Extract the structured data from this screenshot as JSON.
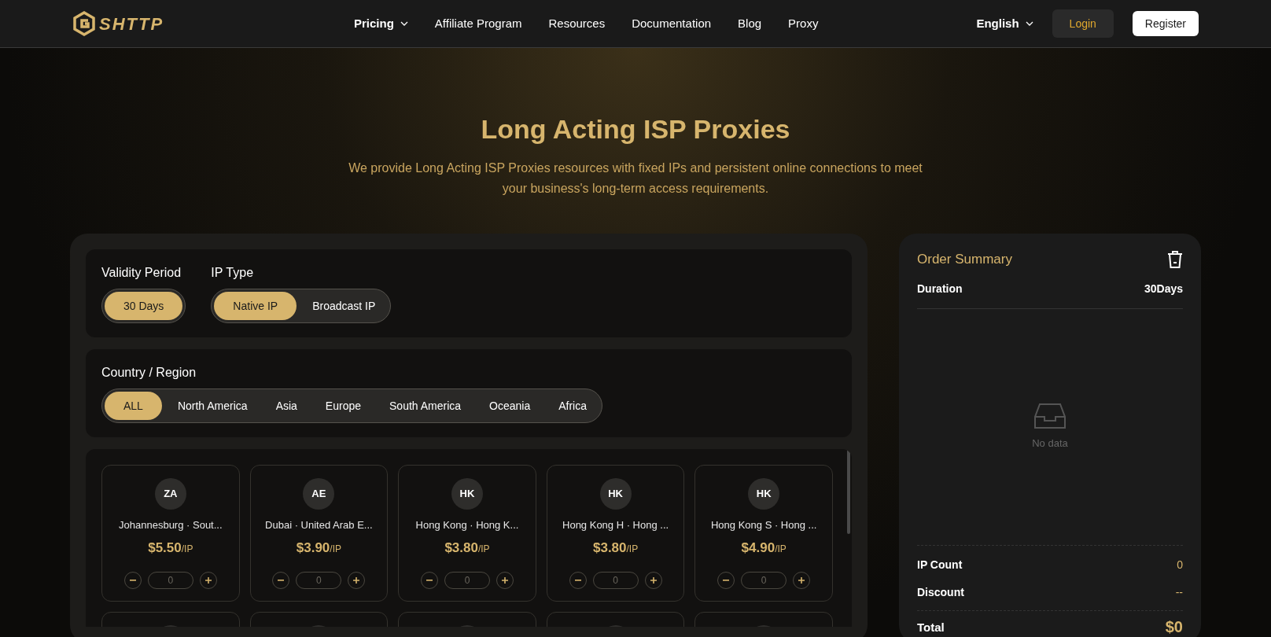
{
  "header": {
    "logo": "SHTTP",
    "nav": [
      {
        "label": "Pricing",
        "dropdown": true
      },
      {
        "label": "Affiliate Program",
        "dropdown": false
      },
      {
        "label": "Resources",
        "dropdown": false
      },
      {
        "label": "Documentation",
        "dropdown": false
      },
      {
        "label": "Blog",
        "dropdown": false
      },
      {
        "label": "Proxy",
        "dropdown": false
      }
    ],
    "language": "English",
    "login": "Login",
    "register": "Register"
  },
  "hero": {
    "title": "Long Acting ISP Proxies",
    "subtitle": "We provide Long Acting ISP Proxies resources with fixed IPs and persistent online connections to meet your business's long-term access requirements."
  },
  "validity_period": {
    "label": "Validity Period",
    "options": [
      {
        "label": "30 Days",
        "selected": true
      }
    ]
  },
  "ip_type": {
    "label": "IP Type",
    "options": [
      {
        "label": "Native IP",
        "selected": true
      },
      {
        "label": "Broadcast IP",
        "selected": false
      }
    ]
  },
  "region": {
    "label": "Country / Region",
    "options": [
      {
        "label": "ALL",
        "selected": true
      },
      {
        "label": "North America",
        "selected": false
      },
      {
        "label": "Asia",
        "selected": false
      },
      {
        "label": "Europe",
        "selected": false
      },
      {
        "label": "South America",
        "selected": false
      },
      {
        "label": "Oceania",
        "selected": false
      },
      {
        "label": "Africa",
        "selected": false
      }
    ]
  },
  "products": [
    {
      "code": "ZA",
      "name": "Johannesburg · Sout...",
      "price": "$5.50",
      "unit": "/IP",
      "quantity": "0"
    },
    {
      "code": "AE",
      "name": "Dubai · United Arab E...",
      "price": "$3.90",
      "unit": "/IP",
      "quantity": "0"
    },
    {
      "code": "HK",
      "name": "Hong Kong · Hong K...",
      "price": "$3.80",
      "unit": "/IP",
      "quantity": "0"
    },
    {
      "code": "HK",
      "name": "Hong Kong H · Hong ...",
      "price": "$3.80",
      "unit": "/IP",
      "quantity": "0"
    },
    {
      "code": "HK",
      "name": "Hong Kong S · Hong ...",
      "price": "$4.90",
      "unit": "/IP",
      "quantity": "0"
    }
  ],
  "summary": {
    "title": "Order Summary",
    "duration_label": "Duration",
    "duration_value": "30Days",
    "empty_text": "No data",
    "ip_count_label": "IP Count",
    "ip_count_value": "0",
    "discount_label": "Discount",
    "discount_value": "--",
    "total_label": "Total",
    "total_value": "$0"
  }
}
